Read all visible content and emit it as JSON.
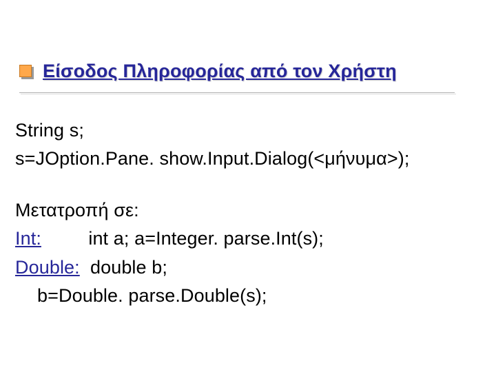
{
  "title": "Είσοδος Πληροφορίας από τον Χρήστη",
  "content": {
    "block1": {
      "line1": "String s;",
      "line2": "s=JOption.Pane. show.Input.Dialog(<μήνυμα>);"
    },
    "block2": {
      "heading": "Μετατροπή σε:",
      "int": {
        "label": "Int:",
        "code": "int a;  a=Integer. parse.Int(s);"
      },
      "double": {
        "label": "Double:",
        "code1": "double b;",
        "code2": "b=Double. parse.Double(s);"
      }
    }
  }
}
